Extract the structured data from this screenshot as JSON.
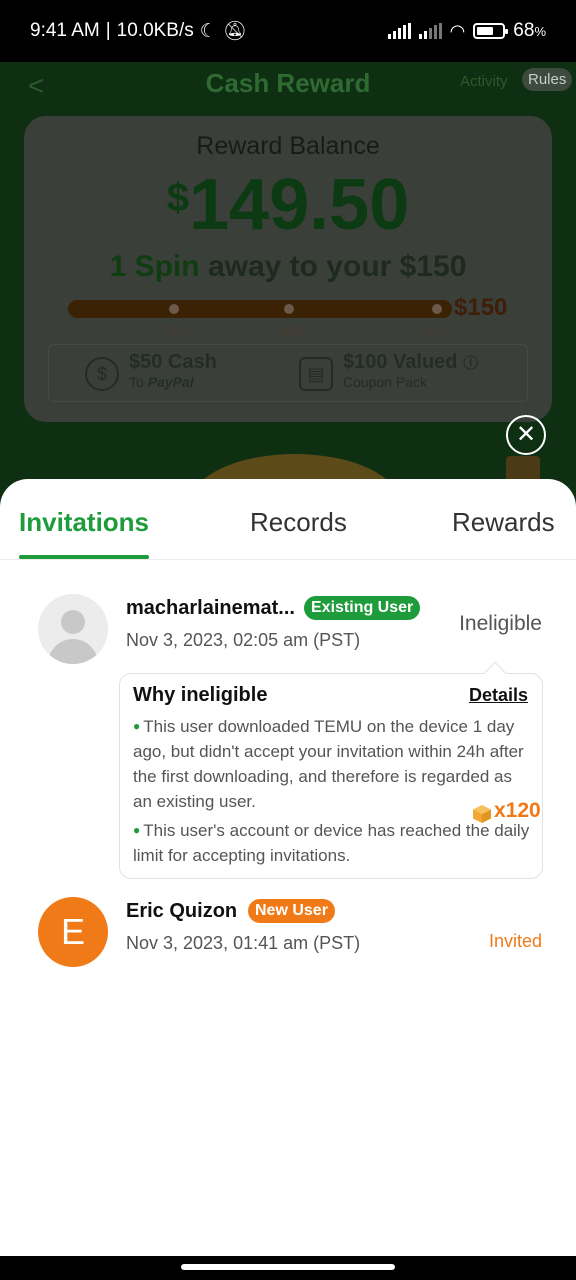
{
  "status_bar": {
    "time": "9:41 AM",
    "speed": "10.0KB/s",
    "battery": "68",
    "battery_unit": "%",
    "battery_level": 0.68
  },
  "background": {
    "back": "<",
    "title": "Cash Reward",
    "activity": "Activity",
    "rules": "Rules",
    "balance_label": "Reward Balance",
    "amount_currency": "$",
    "amount": "149.50",
    "spin_count": "1 Spin",
    "spin_rest": "away to your $150",
    "bar_goal": "$150",
    "progress_ticks": [
      "30%",
      "60%",
      "90%"
    ],
    "reward1_title": "$50 Cash",
    "reward1_sub_to": "To",
    "reward1_sub_brand": "PayPal",
    "reward2_title": "$100 Valued",
    "reward2_sub": "Coupon Pack"
  },
  "close_label": "✕",
  "tabs": [
    {
      "label": "Invitations",
      "active": true
    },
    {
      "label": "Records",
      "active": false
    },
    {
      "label": "Rewards",
      "active": false
    }
  ],
  "invitations": [
    {
      "name": "macharlainemat...",
      "badge": "Existing User",
      "date": "Nov 3, 2023, 02:05 am (PST)",
      "status": "Ineligible"
    },
    {
      "avatar_letter": "E",
      "name": "Eric Quizon",
      "badge": "New User",
      "date": "Nov 3, 2023, 01:41 am (PST)",
      "reward": "x120",
      "status": "Invited"
    }
  ],
  "tooltip": {
    "title": "Why ineligible",
    "details": "Details",
    "bullet_icon": "●",
    "bullets": [
      "This user downloaded TEMU on the device 1 day ago, but didn't accept your invitation within 24h after the first downloading, and therefore is regarded as an existing user.",
      "This user's account or device has reached the daily limit for accepting invitations."
    ]
  },
  "colors": {
    "accent_green": "#1e9b3a",
    "accent_orange": "#f07a17"
  }
}
